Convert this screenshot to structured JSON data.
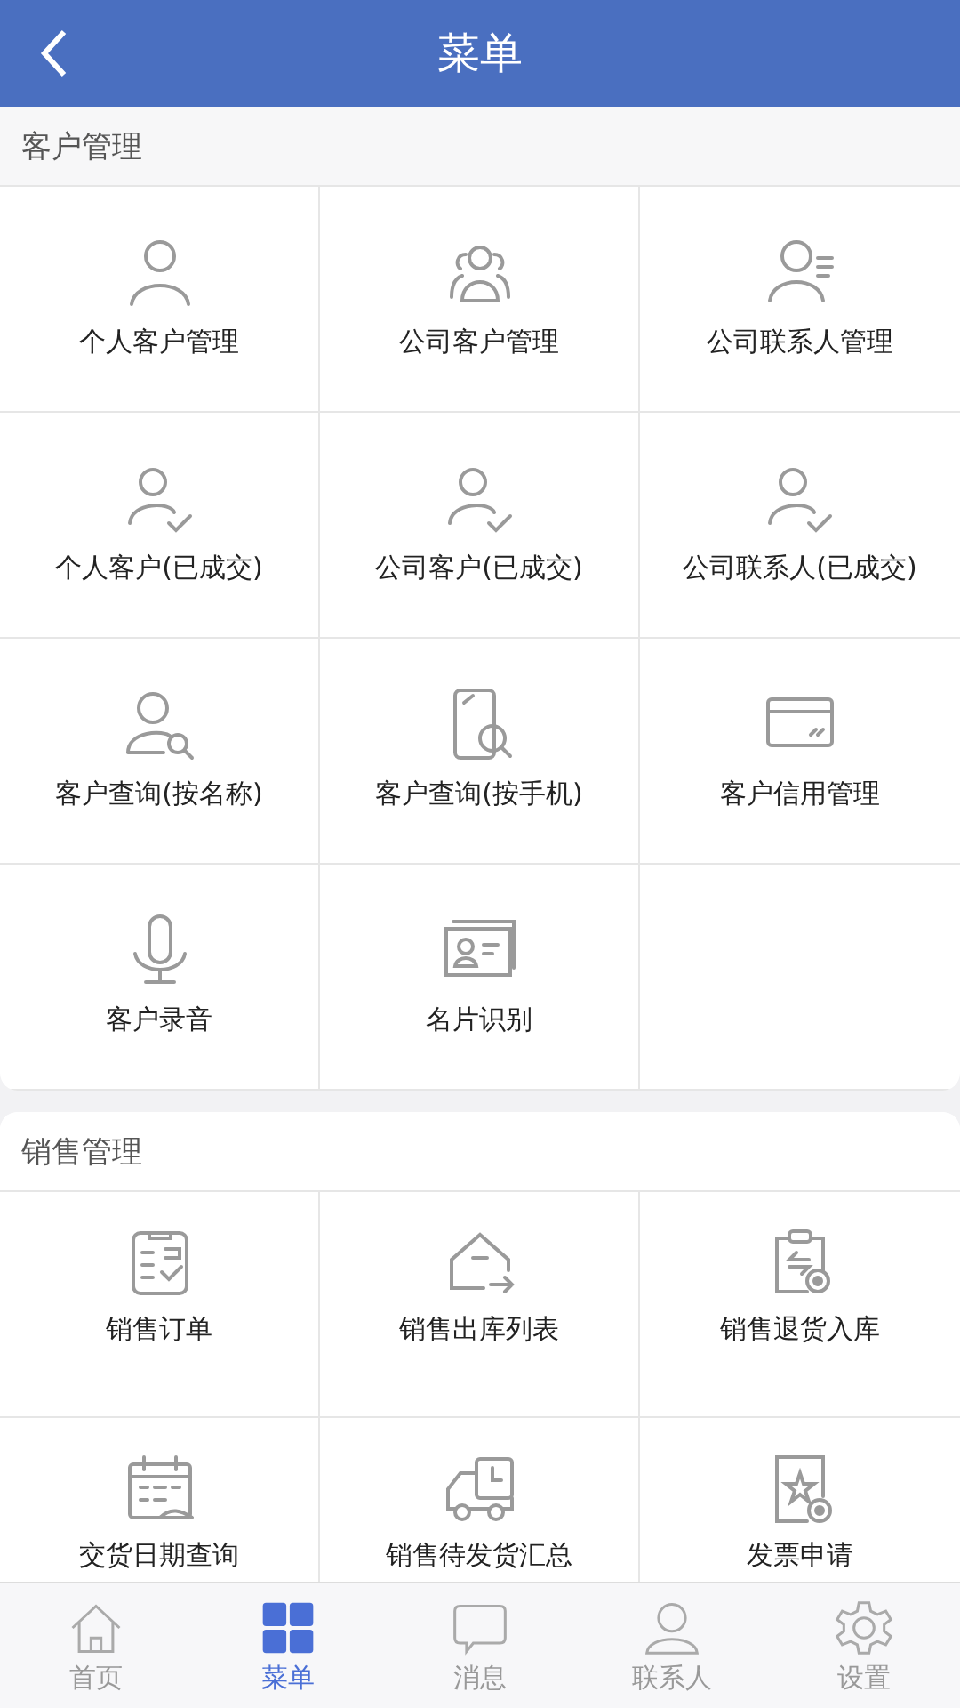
{
  "header": {
    "title": "菜单"
  },
  "sections": [
    {
      "title": "客户管理",
      "items": [
        {
          "label": "个人客户管理",
          "kind": "person"
        },
        {
          "label": "公司客户管理",
          "kind": "group"
        },
        {
          "label": "公司联系人管理",
          "kind": "contact"
        },
        {
          "label": "个人客户(已成交)",
          "kind": "person-check"
        },
        {
          "label": "公司客户(已成交)",
          "kind": "person-check"
        },
        {
          "label": "公司联系人(已成交)",
          "kind": "person-check"
        },
        {
          "label": "客户查询(按名称)",
          "kind": "person-search"
        },
        {
          "label": "客户查询(按手机)",
          "kind": "phone-search"
        },
        {
          "label": "客户信用管理",
          "kind": "card"
        },
        {
          "label": "客户录音",
          "kind": "mic"
        },
        {
          "label": "名片识别",
          "kind": "id-card"
        }
      ]
    },
    {
      "title": "销售管理",
      "items": [
        {
          "label": "销售订单",
          "kind": "clipboard"
        },
        {
          "label": "销售出库列表",
          "kind": "house-out"
        },
        {
          "label": "销售退货入库",
          "kind": "return"
        },
        {
          "label": "交货日期查询",
          "kind": "calendar"
        },
        {
          "label": "销售待发货汇总",
          "kind": "truck"
        },
        {
          "label": "发票申请",
          "kind": "invoice"
        }
      ]
    }
  ],
  "tabs": [
    {
      "label": "首页",
      "kind": "home",
      "selected": false
    },
    {
      "label": "菜单",
      "kind": "grid",
      "selected": true
    },
    {
      "label": "消息",
      "kind": "chat",
      "selected": false
    },
    {
      "label": "联系人",
      "kind": "contact",
      "selected": false
    },
    {
      "label": "设置",
      "kind": "gear",
      "selected": false
    }
  ]
}
